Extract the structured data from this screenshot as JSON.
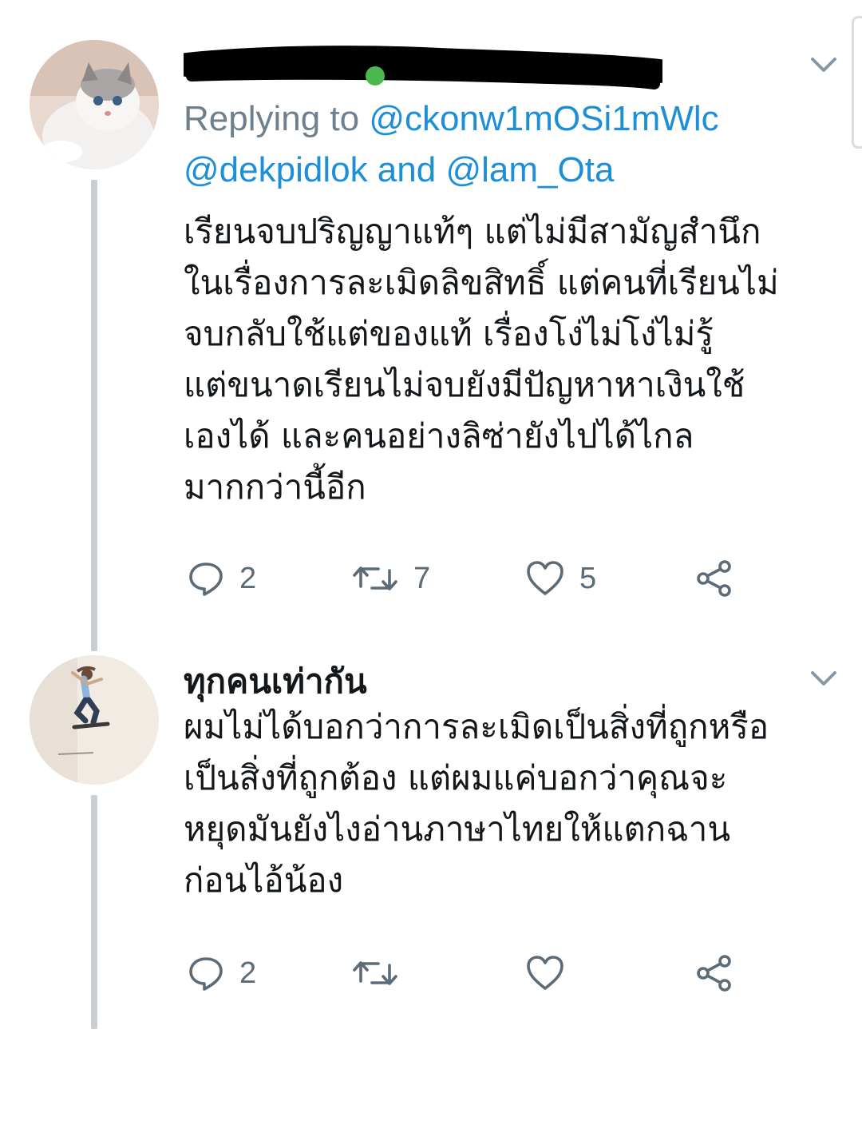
{
  "tweets": [
    {
      "reply_prefix": "Replying to ",
      "reply_mention_1": "@ckonw1mOSi1mWlc",
      "reply_mention_2": "@dekpidlok",
      "reply_and": " and ",
      "reply_mention_3": "@lam_Ota",
      "text_lines": [
        "เรียนจบปริญญาแท้ๆ แต่ไม่มีสามัญสำนึก",
        "ในเรื่องการละเมิดลิขสิทธิ์ แต่คนที่เรียนไม่",
        "จบกลับใช้แต่ของแท้  เรื่องโง่ไม่โง่ไม่รู้",
        "แต่ขนาดเรียนไม่จบยังมีปัญหาหาเงินใช้",
        "เองได้ และคนอย่างลิซ่ายังไปได้ไกล",
        "มากกว่านี้อีก"
      ],
      "reply_count": "2",
      "retweet_count": "7",
      "like_count": "5"
    },
    {
      "display_name": "ทุกคนเท่ากัน",
      "text_lines": [
        "ผมไม่ได้บอกว่าการละเมิดเป็นสิ่งที่ถูกหรือ",
        "เป็นสิ่งที่ถูกต้อง แต่ผมแค่บอกว่าคุณจะ",
        "หยุดมันยังไงอ่านภาษาไทยให้แตกฉาน",
        "ก่อนไอ้น้อง"
      ],
      "reply_count": "2"
    }
  ],
  "icons": {
    "reply": "speech-bubble-icon",
    "retweet": "retweet-arrows-icon",
    "like": "heart-outline-icon",
    "share": "share-nodes-icon",
    "menu": "chevron-down-icon"
  },
  "colors": {
    "link": "#1d8fd6",
    "muted": "#6e7f8d",
    "icon": "#5b6b78",
    "text": "#14171a",
    "thread_line": "#c9ced3"
  }
}
